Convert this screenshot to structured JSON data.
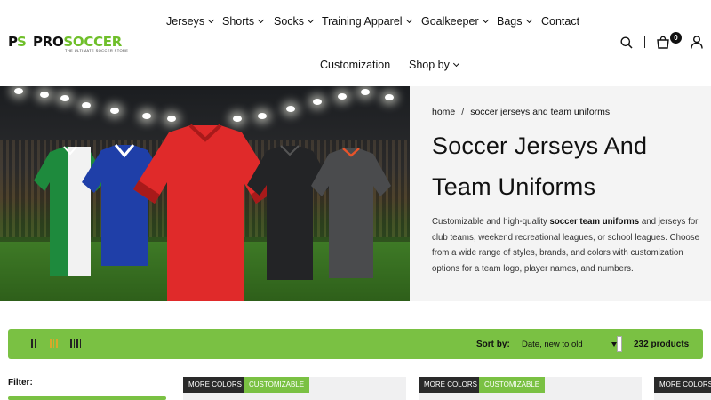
{
  "brand": {
    "mark_left": "P",
    "mark_right": "S",
    "name_a": "PRO",
    "name_b": "SOCCER",
    "tagline": "THE ULTIMATE SOCCER STORE"
  },
  "nav": {
    "items": [
      {
        "label": "Jerseys",
        "dropdown": true
      },
      {
        "label": "Shorts",
        "dropdown": true
      },
      {
        "label": "Socks",
        "dropdown": true
      },
      {
        "label": "Training Apparel",
        "dropdown": true
      },
      {
        "label": "Goalkeeper",
        "dropdown": true
      },
      {
        "label": "Bags",
        "dropdown": true
      },
      {
        "label": "Contact",
        "dropdown": false
      }
    ],
    "row2": [
      {
        "label": "Customization",
        "dropdown": false
      },
      {
        "label": "Shop by",
        "dropdown": true
      }
    ]
  },
  "header_icons": {
    "search": "search-icon",
    "cart": "cart-icon",
    "cart_count": "0",
    "account": "user-icon"
  },
  "hero": {
    "breadcrumb": [
      "home",
      "soccer jerseys and team uniforms"
    ],
    "breadcrumb_sep": "/",
    "title_line1": "Soccer Jerseys And",
    "title_line2": "Team Uniforms",
    "desc_1": "Customizable and high-quality ",
    "desc_bold": "soccer team uniforms",
    "desc_2": " and jerseys for club teams, weekend recreational leagues, or school leagues.  Choose from a wide range of styles, brands, and colors with customization options for a team logo, player names, and numbers."
  },
  "toolbar": {
    "sort_label": "Sort by:",
    "sort_value": "Date, new to old",
    "product_count": "232 products",
    "views": [
      "grid-2-view",
      "grid-3-view",
      "grid-4-view"
    ],
    "active_view": 1
  },
  "filter": {
    "label": "Filter:"
  },
  "cards": [
    {
      "tag1": "MORE COLORS",
      "tag2": "CUSTOMIZABLE"
    },
    {
      "tag1": "MORE COLORS",
      "tag2": "CUSTOMIZABLE"
    },
    {
      "tag1": "MORE COLORS",
      "tag2": ""
    }
  ],
  "colors": {
    "accent_green": "#7ac143",
    "dark_tag": "#2a2a2a",
    "hero_panel": "#f4f4f4"
  }
}
